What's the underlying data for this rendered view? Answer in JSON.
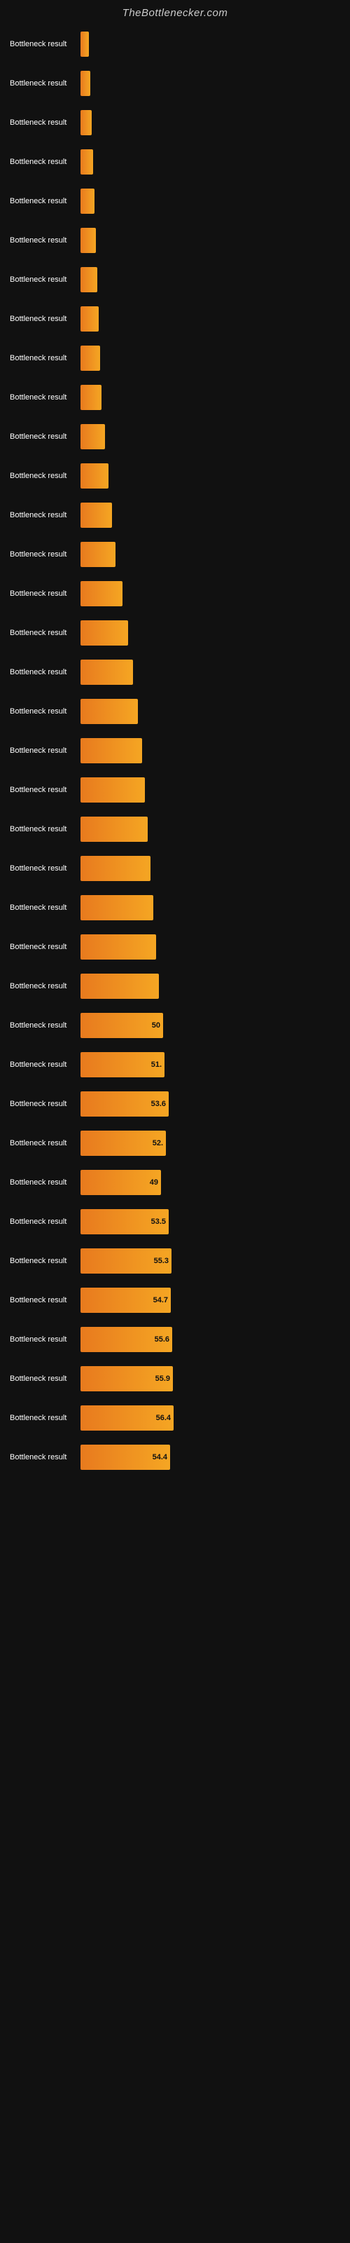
{
  "header": {
    "title": "TheBottlenecker.com"
  },
  "bars": [
    {
      "label": "Bottleneck result",
      "value": null,
      "width": 12
    },
    {
      "label": "Bottleneck result",
      "value": null,
      "width": 14
    },
    {
      "label": "Bottleneck result",
      "value": null,
      "width": 16
    },
    {
      "label": "Bottleneck result",
      "value": null,
      "width": 18
    },
    {
      "label": "Bottleneck result",
      "value": null,
      "width": 20
    },
    {
      "label": "Bottleneck result",
      "value": null,
      "width": 22
    },
    {
      "label": "Bottleneck result",
      "value": null,
      "width": 24
    },
    {
      "label": "Bottleneck result",
      "value": null,
      "width": 26
    },
    {
      "label": "Bottleneck result",
      "value": null,
      "width": 28
    },
    {
      "label": "Bottleneck result",
      "value": null,
      "width": 30
    },
    {
      "label": "Bottleneck result",
      "value": null,
      "width": 35
    },
    {
      "label": "Bottleneck result",
      "value": null,
      "width": 40
    },
    {
      "label": "Bottleneck result",
      "value": null,
      "width": 45
    },
    {
      "label": "Bottleneck result",
      "value": null,
      "width": 50
    },
    {
      "label": "Bottleneck result",
      "value": null,
      "width": 60
    },
    {
      "label": "Bottleneck result",
      "value": null,
      "width": 68
    },
    {
      "label": "Bottleneck result",
      "value": null,
      "width": 75
    },
    {
      "label": "Bottleneck result",
      "value": null,
      "width": 82
    },
    {
      "label": "Bottleneck result",
      "value": null,
      "width": 88
    },
    {
      "label": "Bottleneck result",
      "value": null,
      "width": 92
    },
    {
      "label": "Bottleneck result",
      "value": null,
      "width": 96
    },
    {
      "label": "Bottleneck result",
      "value": null,
      "width": 100
    },
    {
      "label": "Bottleneck result",
      "value": null,
      "width": 104
    },
    {
      "label": "Bottleneck result",
      "value": null,
      "width": 108
    },
    {
      "label": "Bottleneck result",
      "value": null,
      "width": 112
    },
    {
      "label": "Bottleneck result",
      "value": "50",
      "width": 118
    },
    {
      "label": "Bottleneck result",
      "value": "51.",
      "width": 120
    },
    {
      "label": "Bottleneck result",
      "value": "53.6",
      "width": 126
    },
    {
      "label": "Bottleneck result",
      "value": "52.",
      "width": 122
    },
    {
      "label": "Bottleneck result",
      "value": "49",
      "width": 115
    },
    {
      "label": "Bottleneck result",
      "value": "53.5",
      "width": 126
    },
    {
      "label": "Bottleneck result",
      "value": "55.3",
      "width": 130
    },
    {
      "label": "Bottleneck result",
      "value": "54.7",
      "width": 129
    },
    {
      "label": "Bottleneck result",
      "value": "55.6",
      "width": 131
    },
    {
      "label": "Bottleneck result",
      "value": "55.9",
      "width": 132
    },
    {
      "label": "Bottleneck result",
      "value": "56.4",
      "width": 133
    },
    {
      "label": "Bottleneck result",
      "value": "54.4",
      "width": 128
    }
  ]
}
